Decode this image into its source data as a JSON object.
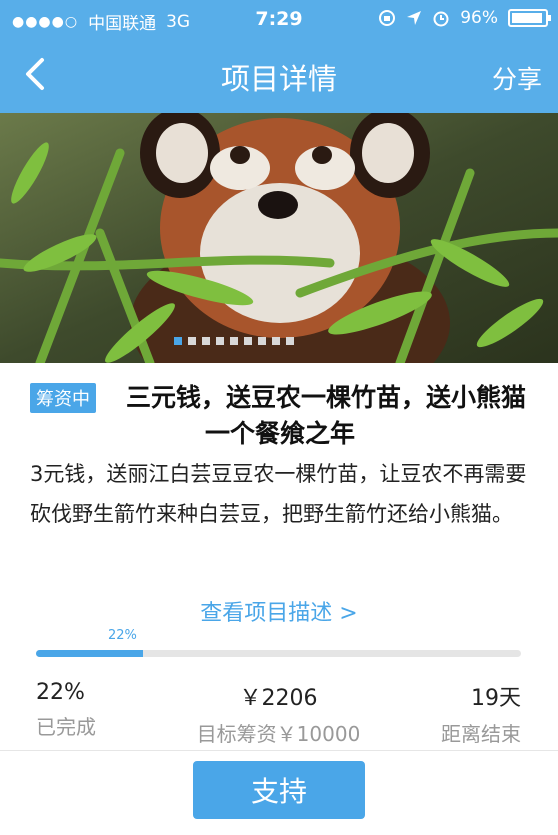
{
  "statusbar": {
    "carrier": "中国联通",
    "network": "3G",
    "time": "7:29",
    "battery": "96%"
  },
  "nav": {
    "title": "项目详情",
    "share_label": "分享"
  },
  "banner": {
    "pages": 9,
    "active_index": 0
  },
  "project": {
    "status_tag": "筹资中",
    "title": "三元钱，送豆农一棵竹苗，送小熊猫一个餐飨之年",
    "description": "3元钱，送丽江白芸豆豆农一棵竹苗，让豆农不再需要砍伐野生箭竹来种白芸豆，把野生箭竹还给小熊猫。",
    "detail_link": "查看项目描述 >"
  },
  "progress": {
    "label": "22%",
    "fraction": 0.22
  },
  "stats": {
    "completed_value": "22%",
    "completed_label": "已完成",
    "raised_value": "￥2206",
    "target_label": "目标筹资￥10000",
    "remaining_value": "19天",
    "remaining_label": "距离结束"
  },
  "actions": {
    "support_label": "支持"
  },
  "colors": {
    "header": "#58aee9",
    "accent": "#4aa6e8"
  }
}
